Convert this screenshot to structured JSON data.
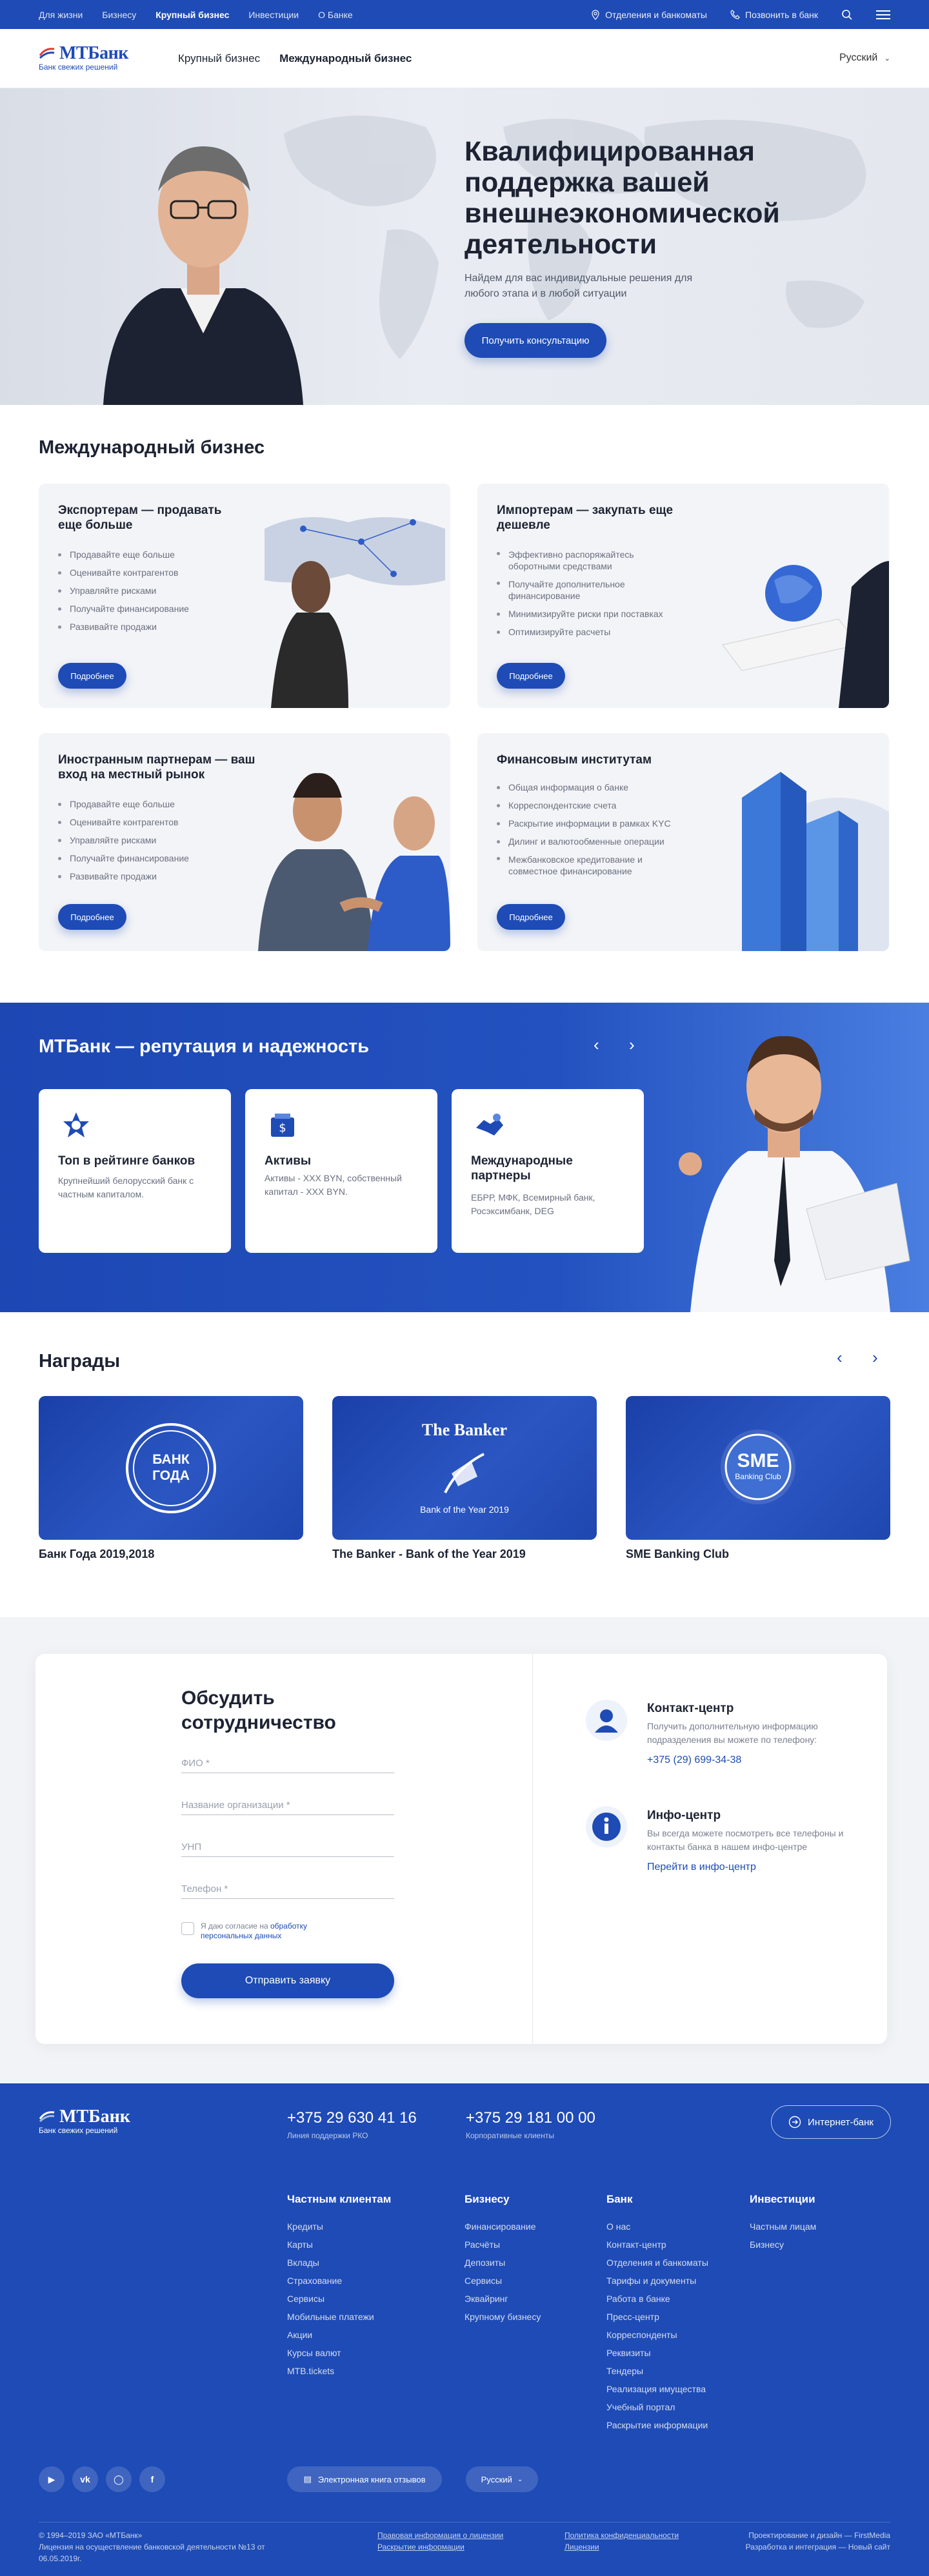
{
  "topbar": {
    "nav": [
      "Для жизни",
      "Бизнесу",
      "Крупный бизнес",
      "Инвестиции",
      "О Банке"
    ],
    "branches": "Отделения и банкоматы",
    "call": "Позвонить в банк"
  },
  "header": {
    "logo": "МТБанк",
    "tagline": "Банк свежих решений",
    "nav": [
      "Крупный бизнес",
      "Международный бизнес"
    ],
    "language": "Русский"
  },
  "hero": {
    "title": "Квалифицированная поддержка вашей внешнеэкономической деятельности",
    "subtitle": "Найдем для вас индивидуальные решения для любого этапа и в любой ситуации",
    "button": "Получить консультацию"
  },
  "international": {
    "title": "Международный бизнес",
    "button": "Подробнее",
    "cards": [
      {
        "title": "Экспортерам — продавать еще больше",
        "items": [
          "Продавайте еще больше",
          "Оценивайте контрагентов",
          "Управляйте рисками",
          "Получайте финансирование",
          "Развивайте продажи"
        ]
      },
      {
        "title": "Импортерам — закупать еще дешевле",
        "items": [
          "Эффективно распоряжайтесь оборотными средствами",
          "Получайте дополнительное финансирование",
          "Минимизируйте риски при поставках",
          "Оптимизируйте расчеты"
        ]
      },
      {
        "title": "Иностранным партнерам — ваш вход на местный рынок",
        "items": [
          "Продавайте еще больше",
          "Оценивайте контрагентов",
          "Управляйте рисками",
          "Получайте финансирование",
          "Развивайте продажи"
        ]
      },
      {
        "title": "Финансовым институтам",
        "items": [
          "Общая информация о банке",
          "Корреспондентские счета",
          "Раскрытие информации в рамках KYC",
          "Дилинг и валютообменные операции",
          "Межбанковское кредитование и совместное финансирование"
        ]
      }
    ]
  },
  "reputation": {
    "title": "МТБанк — репутация и надежность",
    "cards": [
      {
        "title": "Топ в рейтинге банков",
        "text": "Крупнейший белорусский банк с частным капиталом."
      },
      {
        "title": "Активы",
        "text": "Активы - XXX BYN, собственный капитал - XXX BYN."
      },
      {
        "title": "Международные партнеры",
        "text": "ЕБРР, МФК, Всемирный банк, Росэксимбанк, DEG"
      }
    ]
  },
  "awards": {
    "title": "Награды",
    "items": [
      {
        "caption": "Банк Года 2019,2018",
        "badge_line1": "БАНК",
        "badge_line2": "ГОДА"
      },
      {
        "caption": "The Banker - Bank of the Year 2019",
        "badge_line1": "The Banker",
        "badge_line2": "Bank of the Year 2019"
      },
      {
        "caption": "SME Banking Club",
        "badge_line1": "SME",
        "badge_line2": "Banking Club"
      }
    ]
  },
  "contact": {
    "title": "Обсудить сотрудничество",
    "fields": [
      "ФИО *",
      "Название организации *",
      "УНП",
      "Телефон *"
    ],
    "consent_prefix": "Я даю согласие на ",
    "consent_link": "обработку персональных данных",
    "submit": "Отправить заявку",
    "center_title": "Контакт-центр",
    "center_text": "Получить дополнительную информацию подразделения вы можете по телефону:",
    "center_phone": "+375 (29) 699-34-38",
    "info_title": "Инфо-центр",
    "info_text": "Вы всегда можете посмотреть все телефоны и контакты банка в нашем инфо-центре",
    "info_link": "Перейти в инфо-центр"
  },
  "footer": {
    "logo": "МТБанк",
    "tagline": "Банк свежих решений",
    "phone1": "+375 29 630 41 16",
    "phone1_sub": "Линия поддержки РКО",
    "phone2": "+375 29 181 00 00",
    "phone2_sub": "Корпоративные клиенты",
    "internet_bank": "Интернет-банк",
    "columns": [
      {
        "title": "Частным клиентам",
        "items": [
          "Кредиты",
          "Карты",
          "Вклады",
          "Страхование",
          "Сервисы",
          "Мобильные платежи",
          "Акции",
          "Курсы валют",
          "MTB.tickets"
        ]
      },
      {
        "title": "Бизнесу",
        "items": [
          "Финансирование",
          "Расчёты",
          "Депозиты",
          "Сервисы",
          "Эквайринг",
          "Крупному бизнесу"
        ]
      },
      {
        "title": "Банк",
        "items": [
          "О нас",
          "Контакт-центр",
          "Отделения и банкоматы",
          "Тарифы и документы",
          "Работа в банке",
          "Пресс-центр",
          "Корреспонденты",
          "Реквизиты",
          "Тендеры",
          "Реализация имущества",
          "Учебный портал",
          "Раскрытие информации"
        ]
      },
      {
        "title": "Инвестиции",
        "items": [
          "Частным лицам",
          "Бизнесу"
        ]
      }
    ],
    "reviews": "Электронная книга отзывов",
    "language": "Русский",
    "copyright": "© 1994–2019 ЗАО «МТБанк»",
    "license": "Лицензия на осуществление банковской деятельности №13 от 06.05.2019г.",
    "legal_links": [
      {
        "line1": "Правовая информация о лицензии",
        "line2": "Раскрытие информации"
      },
      {
        "line1": "Политика конфиденциальности",
        "line2": "Лицензии"
      },
      {
        "line1": "Проектирование и дизайн — FirstMedia",
        "line2": "Разработка и интеграция — Новый сайт"
      }
    ]
  }
}
